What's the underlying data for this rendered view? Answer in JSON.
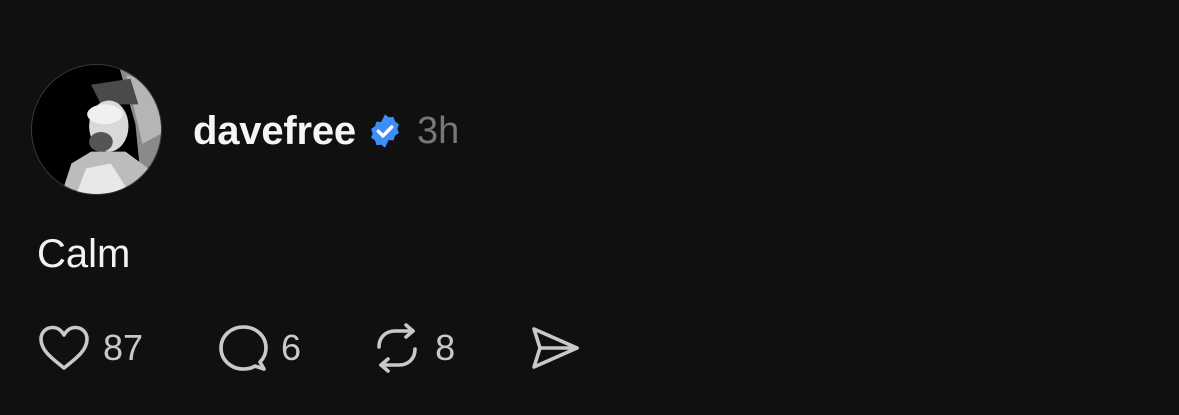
{
  "post": {
    "author": {
      "username": "davefree",
      "verified": true,
      "avatar_icon": "profile-photo"
    },
    "time_ago": "3h",
    "text": "Calm",
    "actions": {
      "like": {
        "icon": "heart-icon",
        "count": "87"
      },
      "reply": {
        "icon": "speech-bubble-icon",
        "count": "6"
      },
      "repost": {
        "icon": "repost-arrows-icon",
        "count": "8"
      },
      "share": {
        "icon": "paper-plane-icon"
      }
    }
  },
  "colors": {
    "background": "#101010",
    "text": "#f3f3f3",
    "muted": "#777777",
    "verified_badge": "#3e8ef7"
  }
}
